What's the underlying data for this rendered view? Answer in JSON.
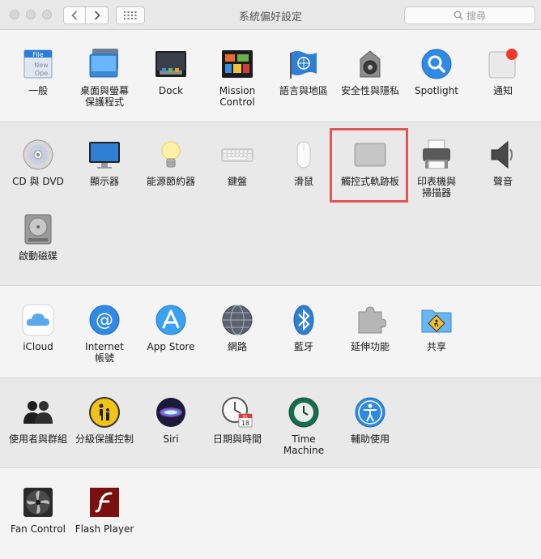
{
  "window": {
    "title": "系統偏好設定",
    "search_placeholder": "搜尋"
  },
  "sections": [
    {
      "items": [
        {
          "id": "general",
          "label": "一般",
          "icon": "general-icon"
        },
        {
          "id": "desktop",
          "label": "桌面與螢幕\n保護程式",
          "icon": "desktop-screensaver-icon"
        },
        {
          "id": "dock",
          "label": "Dock",
          "icon": "dock-icon"
        },
        {
          "id": "mission",
          "label": "Mission\nControl",
          "icon": "mission-control-icon"
        },
        {
          "id": "language",
          "label": "語言與地區",
          "icon": "language-region-icon"
        },
        {
          "id": "security",
          "label": "安全性與隱私",
          "icon": "security-privacy-icon"
        },
        {
          "id": "spotlight",
          "label": "Spotlight",
          "icon": "spotlight-icon"
        },
        {
          "id": "notifications",
          "label": "通知",
          "icon": "notifications-icon"
        }
      ]
    },
    {
      "items": [
        {
          "id": "cddvd",
          "label": "CD 與 DVD",
          "icon": "cd-dvd-icon"
        },
        {
          "id": "display",
          "label": "顯示器",
          "icon": "display-icon"
        },
        {
          "id": "energy",
          "label": "能源節約器",
          "icon": "energy-saver-icon"
        },
        {
          "id": "keyboard",
          "label": "鍵盤",
          "icon": "keyboard-icon"
        },
        {
          "id": "mouse",
          "label": "滑鼠",
          "icon": "mouse-icon"
        },
        {
          "id": "trackpad",
          "label": "觸控式軌跡板",
          "icon": "trackpad-icon"
        },
        {
          "id": "printers",
          "label": "印表機與\n掃描器",
          "icon": "printer-scanner-icon"
        },
        {
          "id": "sound",
          "label": "聲音",
          "icon": "sound-icon"
        },
        {
          "id": "startup",
          "label": "啟動磁碟",
          "icon": "startup-disk-icon"
        }
      ]
    },
    {
      "items": [
        {
          "id": "icloud",
          "label": "iCloud",
          "icon": "icloud-icon"
        },
        {
          "id": "internet",
          "label": "Internet\n帳號",
          "icon": "internet-accounts-icon"
        },
        {
          "id": "appstore",
          "label": "App Store",
          "icon": "app-store-icon"
        },
        {
          "id": "network",
          "label": "網路",
          "icon": "network-icon"
        },
        {
          "id": "bluetooth",
          "label": "藍牙",
          "icon": "bluetooth-icon"
        },
        {
          "id": "extensions",
          "label": "延伸功能",
          "icon": "extensions-icon"
        },
        {
          "id": "sharing",
          "label": "共享",
          "icon": "sharing-icon"
        }
      ]
    },
    {
      "items": [
        {
          "id": "users",
          "label": "使用者與群組",
          "icon": "users-groups-icon"
        },
        {
          "id": "parental",
          "label": "分級保護控制",
          "icon": "parental-controls-icon"
        },
        {
          "id": "siri",
          "label": "Siri",
          "icon": "siri-icon"
        },
        {
          "id": "datetime",
          "label": "日期與時間",
          "icon": "date-time-icon"
        },
        {
          "id": "timemachine",
          "label": "Time Machine",
          "icon": "time-machine-icon"
        },
        {
          "id": "accessibility",
          "label": "輔助使用",
          "icon": "accessibility-icon"
        }
      ]
    },
    {
      "items": [
        {
          "id": "fancontrol",
          "label": "Fan Control",
          "icon": "fan-control-icon"
        },
        {
          "id": "flash",
          "label": "Flash Player",
          "icon": "flash-player-icon"
        }
      ]
    }
  ],
  "icon_text": {
    "general": [
      "File",
      "New",
      "Ope"
    ],
    "calendar_month": "JUL",
    "calendar_day": "18"
  },
  "highlighted_item": "trackpad",
  "highlight_color": "#e05556"
}
